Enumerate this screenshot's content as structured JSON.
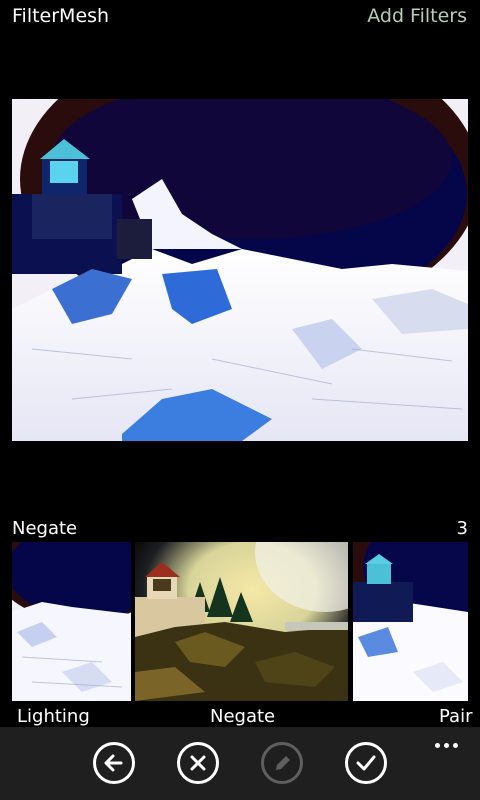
{
  "header": {
    "app_title": "FilterMesh",
    "add_filters_label": "Add Filters"
  },
  "preview": {
    "filter_applied": "Negate"
  },
  "filter_info": {
    "current_filter": "Negate",
    "count": "3"
  },
  "thumbnails": [
    {
      "label": "Lighting",
      "style": "negated"
    },
    {
      "label": "Negate",
      "style": "original"
    },
    {
      "label": "Pair",
      "style": "negated"
    }
  ],
  "app_bar": {
    "buttons": [
      {
        "name": "back",
        "icon": "arrow-left-icon",
        "enabled": true
      },
      {
        "name": "cancel",
        "icon": "x-icon",
        "enabled": true
      },
      {
        "name": "edit",
        "icon": "pencil-icon",
        "enabled": false
      },
      {
        "name": "accept",
        "icon": "check-icon",
        "enabled": true
      }
    ],
    "more_icon": "ellipsis-icon"
  },
  "colors": {
    "background": "#000000",
    "app_bar": "#1f1f1f",
    "accent_text": "#b7cbb7",
    "disabled": "#5f5f5f"
  }
}
